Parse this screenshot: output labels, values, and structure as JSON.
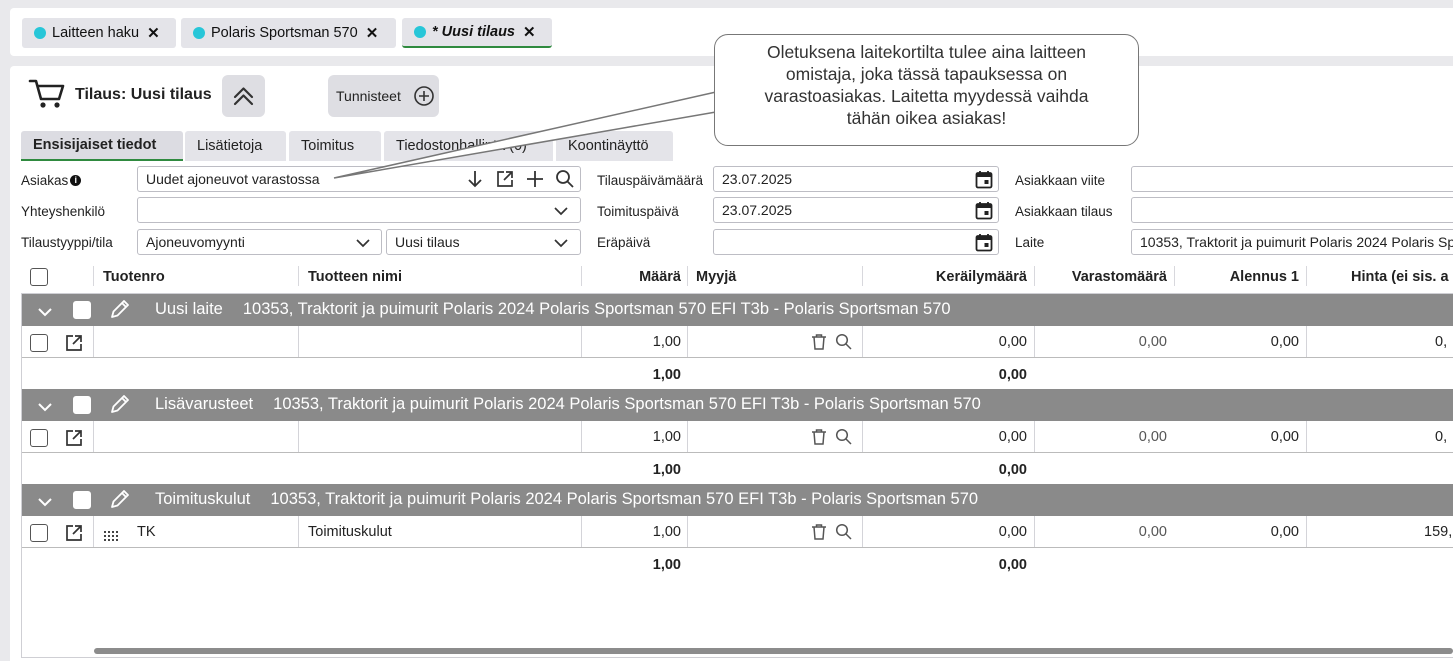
{
  "top_tabs": [
    {
      "label": "Laitteen haku"
    },
    {
      "label": "Polaris Sportsman 570"
    },
    {
      "label": "* Uusi tilaus"
    }
  ],
  "order": {
    "title": "Tilaus: Uusi tilaus",
    "tags_button": "Tunnisteet"
  },
  "sub_tabs": [
    {
      "label": "Ensisijaiset tiedot"
    },
    {
      "label": "Lisätietoja"
    },
    {
      "label": "Toimitus"
    },
    {
      "label": "Tiedostonhallinta (0)"
    },
    {
      "label": "Koontinäyttö"
    }
  ],
  "form": {
    "asiakas_label": "Asiakas",
    "asiakas_value": "Uudet ajoneuvot varastossa",
    "yhteyshenkilo_label": "Yhteyshenkilö",
    "yhteyshenkilo_value": "",
    "tilaustyyppi_label": "Tilaustyyppi/tila",
    "tilaustyyppi_value": "Ajoneuvomyynti",
    "tila_value": "Uusi tilaus",
    "tilauspvm_label": "Tilauspäivämäärä",
    "tilauspvm_value": "23.07.2025",
    "toimituspvm_label": "Toimituspäivä",
    "toimituspvm_value": "23.07.2025",
    "erapaiva_label": "Eräpäivä",
    "erapaiva_value": "",
    "asiakkaan_viite_label": "Asiakkaan viite",
    "asiakkaan_tilaus_label": "Asiakkaan tilaus",
    "laite_label": "Laite",
    "laite_value": "10353, Traktorit ja puimurit Polaris 2024 Polaris Sp"
  },
  "grid": {
    "headers": {
      "tuotenro": "Tuotenro",
      "nimi": "Tuotteen nimi",
      "maara": "Määrä",
      "myyja": "Myyjä",
      "kerailymaara": "Keräilymäärä",
      "varastomaara": "Varastomäärä",
      "alennus": "Alennus 1",
      "hinta": "Hinta (ei sis. a"
    },
    "groups": [
      {
        "name": "Uusi laite",
        "desc": "10353, Traktorit ja puimurit Polaris 2024 Polaris Sportsman 570 EFI T3b - Polaris Sportsman 570",
        "row": {
          "tuotenro": "",
          "nimi": "",
          "maara": "1,00",
          "keraily": "0,00",
          "varasto": "0,00",
          "alennus": "0,00",
          "hinta": "0,"
        },
        "sum": {
          "maara": "1,00",
          "keraily": "0,00"
        }
      },
      {
        "name": "Lisävarusteet",
        "desc": "10353, Traktorit ja puimurit Polaris 2024 Polaris Sportsman 570 EFI T3b - Polaris Sportsman 570",
        "row": {
          "tuotenro": "",
          "nimi": "",
          "maara": "1,00",
          "keraily": "0,00",
          "varasto": "0,00",
          "alennus": "0,00",
          "hinta": "0,"
        },
        "sum": {
          "maara": "1,00",
          "keraily": "0,00"
        }
      },
      {
        "name": "Toimituskulut",
        "desc": "10353, Traktorit ja puimurit Polaris 2024 Polaris Sportsman 570 EFI T3b - Polaris Sportsman 570",
        "row": {
          "tuotenro": "TK",
          "nimi": "Toimituskulut",
          "maara": "1,00",
          "keraily": "0,00",
          "varasto": "0,00",
          "alennus": "0,00",
          "hinta": "159,"
        },
        "sum": {
          "maara": "1,00",
          "keraily": "0,00"
        }
      }
    ]
  },
  "callout": {
    "line1": "Oletuksena laitekortilta tulee aina laitteen",
    "line2": "omistaja, joka tässä tapauksessa on",
    "line3": "varastoasiakas. Laitetta myydessä vaihda",
    "line4": "tähän oikea asiakas!"
  },
  "colors": {
    "tab_dot": "#27c6d8",
    "active_underline": "#2f8a3f",
    "group_bar": "#8a8a8a"
  }
}
